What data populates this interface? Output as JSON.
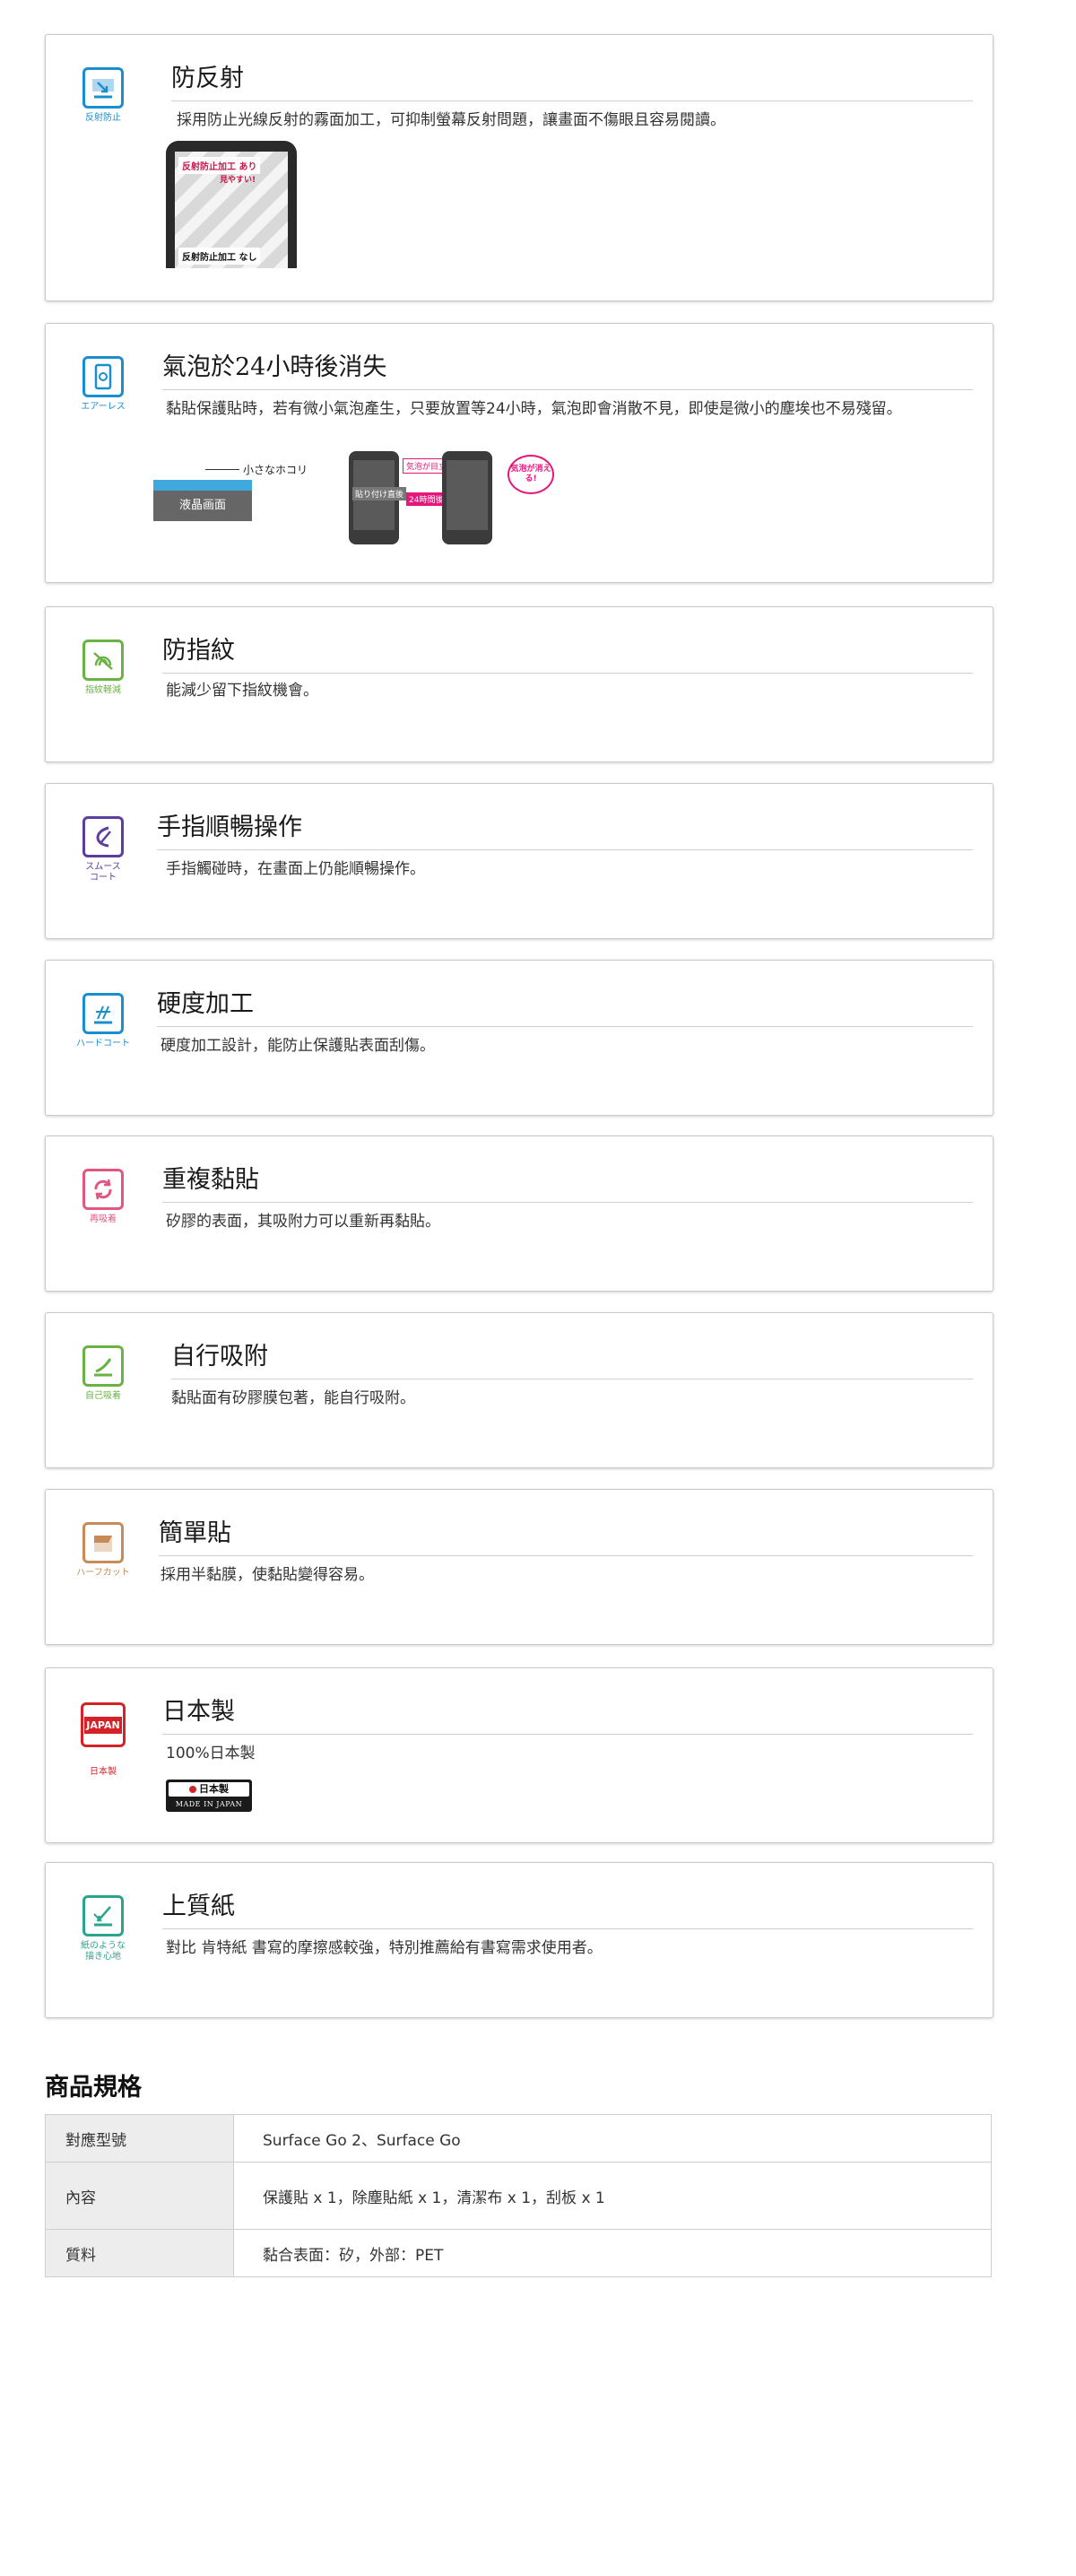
{
  "features": [
    {
      "title": "防反射",
      "caption": "反射防止",
      "desc": "採用防止光線反射的霧面加工，可抑制螢幕反射問題，讓畫面不傷眼且容易閱讀。",
      "illo": {
        "top_label": "反射防止加工 あり",
        "sub_label": "見やすい!",
        "bottom_label": "反射防止加工 なし"
      }
    },
    {
      "title": "氣泡於24小時後消失",
      "caption": "エアーレス",
      "desc": "黏貼保護貼時，若有微小氣泡產生，只要放置等24小時，氣泡即會消散不見，即使是微小的塵埃也不易殘留。",
      "illo": {
        "dust_label": "小さなホコリ",
        "screen_label": "液晶画面",
        "tag_apply": "貼り付け直後",
        "tag_time": "24時間後",
        "tag_bubble": "気泡が目立つ",
        "speech": "気泡が消える!"
      }
    },
    {
      "title": "防指紋",
      "caption": "指紋軽減",
      "desc": "能減少留下指紋機會。"
    },
    {
      "title": "手指順暢操作",
      "caption": "スムース\nコート",
      "desc": "手指觸碰時，在畫面上仍能順暢操作。"
    },
    {
      "title": "硬度加工",
      "caption": "ハードコート",
      "desc": "硬度加工設計，能防止保護貼表面刮傷。"
    },
    {
      "title": "重複黏貼",
      "caption": "再吸着",
      "desc": "矽膠的表面，其吸附力可以重新再黏貼。"
    },
    {
      "title": "自行吸附",
      "caption": "自己吸着",
      "desc": "黏貼面有矽膠膜包著，能自行吸附。"
    },
    {
      "title": "簡單貼",
      "caption": "ハーフカット",
      "desc": "採用半黏膜，使黏貼變得容易。"
    },
    {
      "title": "日本製",
      "caption": "日本製",
      "icon_text": "JAPAN",
      "desc": "100%日本製",
      "badge": {
        "main": "日本製",
        "sub": "MADE IN JAPAN"
      }
    },
    {
      "title": "上質紙",
      "caption": "紙のような\n描き心地",
      "desc": "對比 肯特紙 書寫的摩擦感較強，特別推薦給有書寫需求使用者。"
    }
  ],
  "spec": {
    "title": "商品規格",
    "rows": [
      {
        "key": "對應型號",
        "value": "Surface Go 2、Surface Go"
      },
      {
        "key": "內容",
        "value": "保護貼 x 1，除塵貼紙 x 1，清潔布 x 1，刮板 x 1"
      },
      {
        "key": "質料",
        "value": "黏合表面：矽，外部：PET"
      }
    ]
  },
  "colors": {
    "blue": "#1a8fcf",
    "green": "#6ab244",
    "purple": "#5b3e9e",
    "pink": "#e2577f",
    "orange": "#c88a56",
    "red": "#d42229",
    "teal": "#2aa58d",
    "magenta": "#e6177a"
  },
  "icons": [
    "anti-glare-icon",
    "airless-icon",
    "fingerprint-icon",
    "smooth-coat-icon",
    "hard-coat-icon",
    "reusable-icon",
    "self-adhesive-icon",
    "half-cut-icon",
    "japan-icon",
    "paper-feel-icon"
  ]
}
